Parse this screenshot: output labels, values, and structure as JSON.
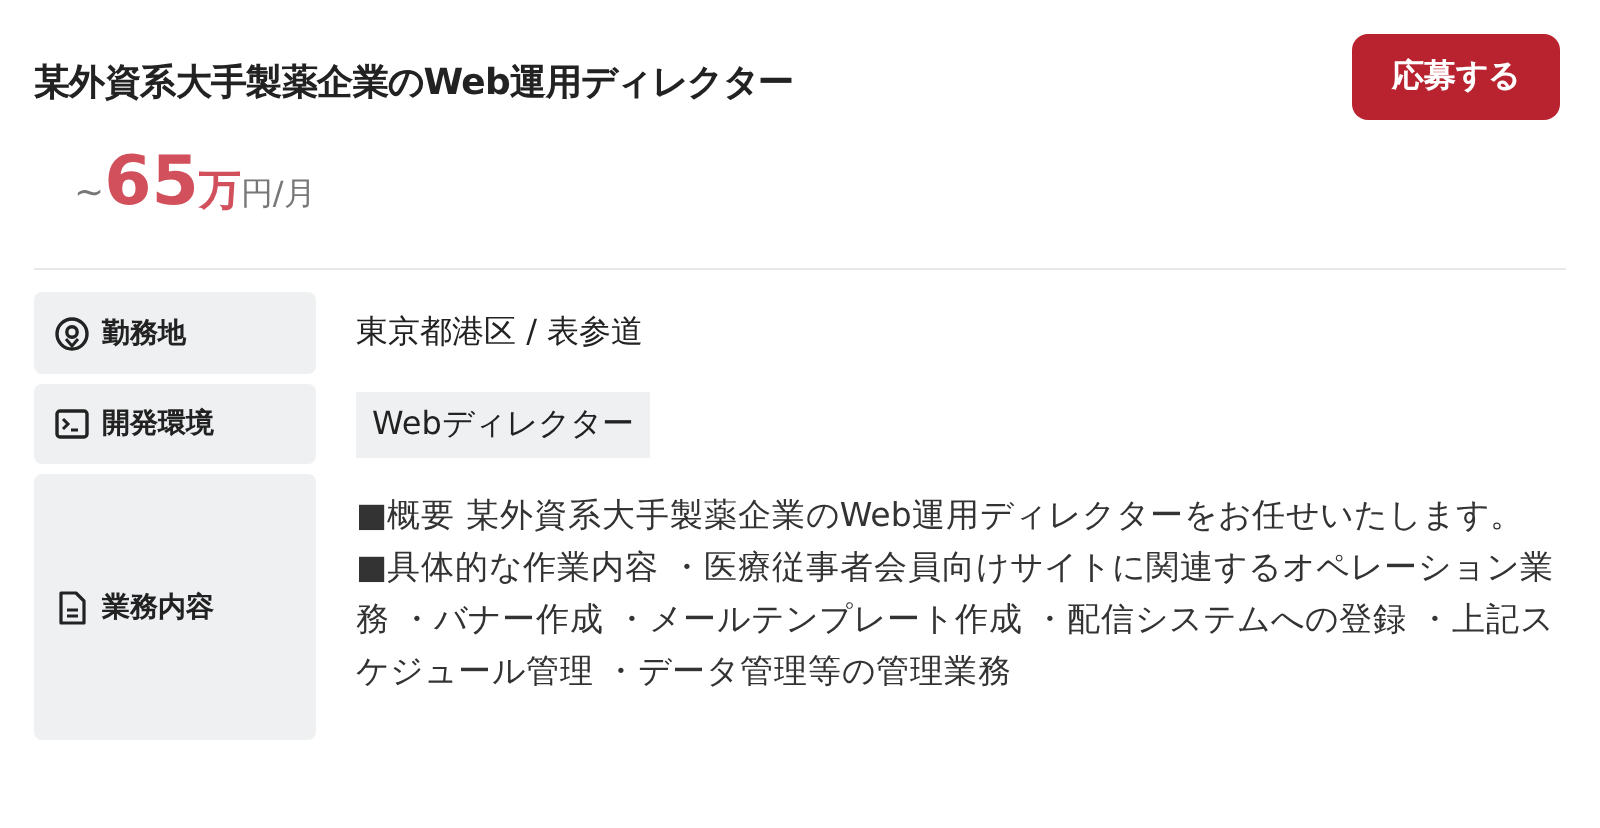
{
  "job": {
    "title": "某外資系大手製薬企業のWeb運用ディレクター",
    "apply_button": "応募する",
    "salary": {
      "prefix": "~",
      "amount": "65",
      "unit": "万",
      "suffix": "円/月"
    }
  },
  "details": [
    {
      "kind": "text",
      "label": "勤務地",
      "value": "東京都港区 / 表参道"
    },
    {
      "kind": "tag",
      "label": "開発環境",
      "value": "Webディレクター"
    },
    {
      "kind": "paragraph",
      "label": "業務内容",
      "value": "■概要 某外資系大手製薬企業のWeb運用ディレクターをお任せいたします。 ■具体的な作業内容 ・医療従事者会員向けサイトに関連するオペレーション業務 ・バナー作成 ・メールテンプレート作成 ・配信システムへの登録 ・上記スケジュール管理 ・データ管理等の管理業務"
    }
  ]
}
